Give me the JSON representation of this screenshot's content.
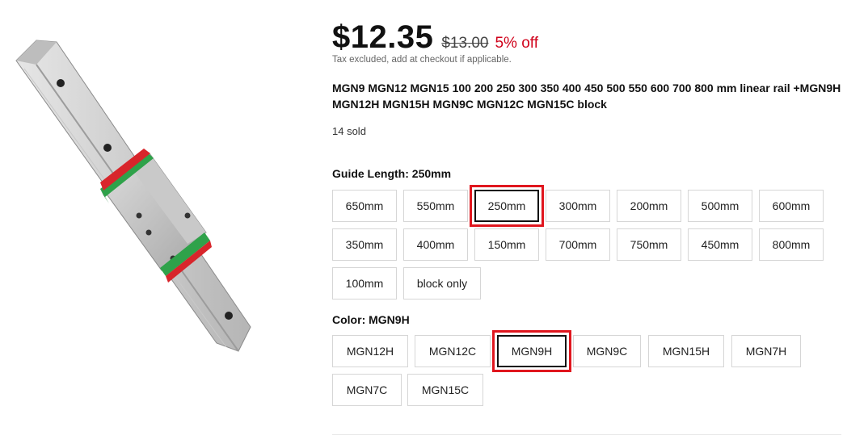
{
  "product": {
    "price": "$12.35",
    "original_price": "$13.00",
    "discount": "5% off",
    "tax_note": "Tax excluded, add at checkout if applicable.",
    "title": "MGN9 MGN12 MGN15 100 200 250 300 350 400 450 500 550 600 700 800 mm linear rail +MGN9H MGN12H MGN15H MGN9C MGN12C MGN15C block",
    "sold": "14 sold"
  },
  "guide_length": {
    "label": "Guide Length",
    "separator": ": ",
    "selected": "250mm",
    "options": [
      "650mm",
      "550mm",
      "250mm",
      "300mm",
      "200mm",
      "500mm",
      "600mm",
      "350mm",
      "400mm",
      "150mm",
      "700mm",
      "750mm",
      "450mm",
      "800mm",
      "100mm",
      "block only"
    ]
  },
  "color": {
    "label": "Color",
    "separator": ": ",
    "selected": "MGN9H",
    "options": [
      "MGN12H",
      "MGN12C",
      "MGN9H",
      "MGN9C",
      "MGN15H",
      "MGN7H",
      "MGN7C",
      "MGN15C"
    ]
  },
  "colors": {
    "discount_red": "#d0021b",
    "highlight_red": "#e0161e",
    "selected_border": "#111111"
  }
}
